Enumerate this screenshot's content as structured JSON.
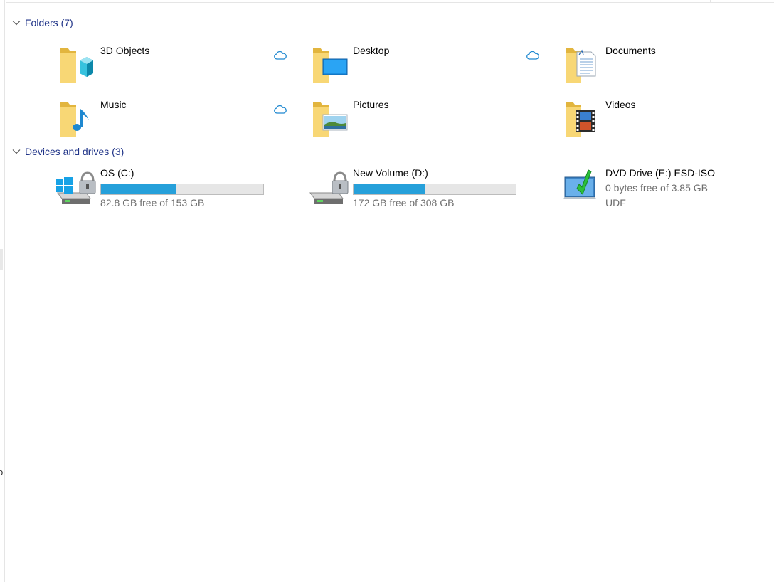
{
  "folders_group": {
    "title": "Folders (7)",
    "items": [
      {
        "name": "3D Objects",
        "icon": "3d-objects-folder-icon",
        "cloud": true
      },
      {
        "name": "Desktop",
        "icon": "desktop-folder-icon",
        "cloud": true
      },
      {
        "name": "Documents",
        "icon": "documents-folder-icon",
        "cloud": false
      },
      {
        "name": "Music",
        "icon": "music-folder-icon",
        "cloud": true
      },
      {
        "name": "Pictures",
        "icon": "pictures-folder-icon",
        "cloud": false
      },
      {
        "name": "Videos",
        "icon": "videos-folder-icon",
        "cloud": false
      }
    ]
  },
  "drives_group": {
    "title": "Devices and drives (3)",
    "drives": [
      {
        "name": "OS (C:)",
        "free_text": "82.8 GB free of 153 GB",
        "used_fraction": 0.46,
        "icon": "windows-drive-locked-icon"
      },
      {
        "name": "New Volume (D:)",
        "free_text": "172 GB free of 308 GB",
        "used_fraction": 0.44,
        "icon": "drive-locked-icon"
      },
      {
        "name": "DVD Drive (E:) ESD-ISO",
        "free_text": "0 bytes free of 3.85 GB",
        "fs": "UDF",
        "icon": "dvd-drive-icon"
      }
    ]
  },
  "colors": {
    "header_text": "#1e3287",
    "progress_fill": "#26a0da",
    "cloud_icon": "#1e88d0",
    "folder_yellow": "#f8d775"
  }
}
